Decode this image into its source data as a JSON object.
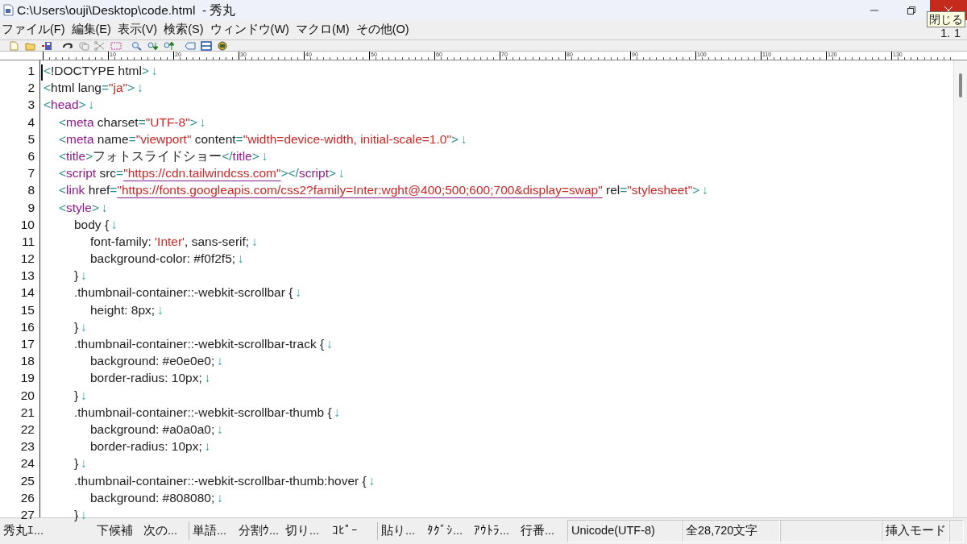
{
  "window": {
    "title": "C:\\Users\\ouji\\Desktop\\code.html  - 秀丸",
    "tooltip": "閉じる"
  },
  "menu": [
    "ファイル(F)",
    "編集(E)",
    "表示(V)",
    "検索(S)",
    "ウィンドウ(W)",
    "マクロ(M)",
    "その他(O)"
  ],
  "cursor_position": "1. 1",
  "ruler": [
    "10",
    "20",
    "30",
    "40",
    "50",
    "60",
    "70",
    "80",
    "90",
    "100",
    "110",
    "120",
    "130"
  ],
  "editor": {
    "lines": [
      {
        "number": "1",
        "kind": "top",
        "parts": [
          {
            "kind": "bracket",
            "text": "<"
          },
          {
            "kind": "text",
            "text": "!DOCTYPE html"
          },
          {
            "kind": "bracket",
            "text": ">"
          },
          {
            "kind": "eol",
            "text": "↓"
          }
        ]
      },
      {
        "number": "2",
        "kind": "top",
        "parts": [
          {
            "kind": "bracket",
            "text": "<"
          },
          {
            "kind": "text",
            "text": "html lang"
          },
          {
            "kind": "bracket",
            "text": "="
          },
          {
            "kind": "string",
            "text": "\"ja\""
          },
          {
            "kind": "bracket",
            "text": ">"
          },
          {
            "kind": "eol",
            "text": "↓"
          }
        ]
      },
      {
        "number": "3",
        "kind": "top",
        "parts": [
          {
            "kind": "bracket",
            "text": "<"
          },
          {
            "kind": "tag",
            "text": "head"
          },
          {
            "kind": "bracket",
            "text": ">"
          },
          {
            "kind": "eol",
            "text": "↓"
          }
        ]
      },
      {
        "number": "4",
        "kind": "element",
        "parts": [
          {
            "kind": "bracket",
            "text": "<"
          },
          {
            "kind": "tag",
            "text": "meta"
          },
          {
            "kind": "text",
            "text": " charset"
          },
          {
            "kind": "bracket",
            "text": "="
          },
          {
            "kind": "string",
            "text": "\"UTF-8\""
          },
          {
            "kind": "bracket",
            "text": ">"
          },
          {
            "kind": "eol",
            "text": "↓"
          }
        ]
      },
      {
        "number": "5",
        "kind": "element",
        "parts": [
          {
            "kind": "bracket",
            "text": "<"
          },
          {
            "kind": "tag",
            "text": "meta"
          },
          {
            "kind": "text",
            "text": " name"
          },
          {
            "kind": "bracket",
            "text": "="
          },
          {
            "kind": "string",
            "text": "\"viewport\""
          },
          {
            "kind": "text",
            "text": " content"
          },
          {
            "kind": "bracket",
            "text": "="
          },
          {
            "kind": "string",
            "text": "\"width=device-width, initial-scale=1.0\""
          },
          {
            "kind": "bracket",
            "text": ">"
          },
          {
            "kind": "eol",
            "text": "↓"
          }
        ]
      },
      {
        "number": "6",
        "kind": "element",
        "parts": [
          {
            "kind": "bracket",
            "text": "<"
          },
          {
            "kind": "tag",
            "text": "title"
          },
          {
            "kind": "bracket",
            "text": ">"
          },
          {
            "kind": "text",
            "text": "フォトスライドショー"
          },
          {
            "kind": "bracket",
            "text": "</"
          },
          {
            "kind": "tag",
            "text": "title"
          },
          {
            "kind": "bracket",
            "text": ">"
          },
          {
            "kind": "eol",
            "text": "↓"
          }
        ]
      },
      {
        "number": "7",
        "kind": "element",
        "parts": [
          {
            "kind": "bracket",
            "text": "<"
          },
          {
            "kind": "tag",
            "text": "script"
          },
          {
            "kind": "text",
            "text": " src"
          },
          {
            "kind": "bracket",
            "text": "="
          },
          {
            "kind": "url",
            "text": "\"https://cdn.tailwindcss.com\""
          },
          {
            "kind": "bracket",
            "text": "></"
          },
          {
            "kind": "tag",
            "text": "script"
          },
          {
            "kind": "bracket",
            "text": ">"
          },
          {
            "kind": "eol",
            "text": "↓"
          }
        ]
      },
      {
        "number": "8",
        "kind": "element",
        "parts": [
          {
            "kind": "bracket",
            "text": "<"
          },
          {
            "kind": "tag",
            "text": "link"
          },
          {
            "kind": "text",
            "text": " href"
          },
          {
            "kind": "bracket",
            "text": "="
          },
          {
            "kind": "url",
            "text": "\"https://fonts.googleapis.com/css2?family=Inter:wght@400;500;600;700&display=swap\""
          },
          {
            "kind": "text",
            "text": " rel"
          },
          {
            "kind": "bracket",
            "text": "="
          },
          {
            "kind": "string",
            "text": "\"stylesheet\""
          },
          {
            "kind": "bracket",
            "text": ">"
          },
          {
            "kind": "eol",
            "text": "↓"
          }
        ]
      },
      {
        "number": "9",
        "kind": "element",
        "parts": [
          {
            "kind": "bracket",
            "text": "<"
          },
          {
            "kind": "tag",
            "text": "style"
          },
          {
            "kind": "bracket",
            "text": ">"
          },
          {
            "kind": "eol",
            "text": "↓"
          }
        ]
      },
      {
        "number": "10",
        "kind": "selector",
        "parts": [
          {
            "kind": "text",
            "text": "body {"
          },
          {
            "kind": "eol",
            "text": "↓"
          }
        ]
      },
      {
        "number": "11",
        "kind": "declaration",
        "parts": [
          {
            "kind": "text",
            "text": "font-family: "
          },
          {
            "kind": "string",
            "text": "'Inter'"
          },
          {
            "kind": "text",
            "text": ", sans-serif;"
          },
          {
            "kind": "eol",
            "text": "↓"
          }
        ]
      },
      {
        "number": "12",
        "kind": "declaration",
        "parts": [
          {
            "kind": "text",
            "text": "background-color: #f0f2f5;"
          },
          {
            "kind": "eol",
            "text": "↓"
          }
        ]
      },
      {
        "number": "13",
        "kind": "selector",
        "parts": [
          {
            "kind": "text",
            "text": "}"
          },
          {
            "kind": "eol",
            "text": "↓"
          }
        ]
      },
      {
        "number": "14",
        "kind": "selector",
        "parts": [
          {
            "kind": "text",
            "text": ".thumbnail-container::-webkit-scrollbar {"
          },
          {
            "kind": "eol",
            "text": "↓"
          }
        ]
      },
      {
        "number": "15",
        "kind": "declaration",
        "parts": [
          {
            "kind": "text",
            "text": "height: 8px;"
          },
          {
            "kind": "eol",
            "text": "↓"
          }
        ]
      },
      {
        "number": "16",
        "kind": "selector",
        "parts": [
          {
            "kind": "text",
            "text": "}"
          },
          {
            "kind": "eol",
            "text": "↓"
          }
        ]
      },
      {
        "number": "17",
        "kind": "selector",
        "parts": [
          {
            "kind": "text",
            "text": ".thumbnail-container::-webkit-scrollbar-track {"
          },
          {
            "kind": "eol",
            "text": "↓"
          }
        ]
      },
      {
        "number": "18",
        "kind": "declaration",
        "parts": [
          {
            "kind": "text",
            "text": "background: #e0e0e0;"
          },
          {
            "kind": "eol",
            "text": "↓"
          }
        ]
      },
      {
        "number": "19",
        "kind": "declaration",
        "parts": [
          {
            "kind": "text",
            "text": "border-radius: 10px;"
          },
          {
            "kind": "eol",
            "text": "↓"
          }
        ]
      },
      {
        "number": "20",
        "kind": "selector",
        "parts": [
          {
            "kind": "text",
            "text": "}"
          },
          {
            "kind": "eol",
            "text": "↓"
          }
        ]
      },
      {
        "number": "21",
        "kind": "selector",
        "parts": [
          {
            "kind": "text",
            "text": ".thumbnail-container::-webkit-scrollbar-thumb {"
          },
          {
            "kind": "eol",
            "text": "↓"
          }
        ]
      },
      {
        "number": "22",
        "kind": "declaration",
        "parts": [
          {
            "kind": "text",
            "text": "background: #a0a0a0;"
          },
          {
            "kind": "eol",
            "text": "↓"
          }
        ]
      },
      {
        "number": "23",
        "kind": "declaration",
        "parts": [
          {
            "kind": "text",
            "text": "border-radius: 10px;"
          },
          {
            "kind": "eol",
            "text": "↓"
          }
        ]
      },
      {
        "number": "24",
        "kind": "selector",
        "parts": [
          {
            "kind": "text",
            "text": "}"
          },
          {
            "kind": "eol",
            "text": "↓"
          }
        ]
      },
      {
        "number": "25",
        "kind": "selector",
        "parts": [
          {
            "kind": "text",
            "text": ".thumbnail-container::-webkit-scrollbar-thumb:hover {"
          },
          {
            "kind": "eol",
            "text": "↓"
          }
        ]
      },
      {
        "number": "26",
        "kind": "declaration",
        "parts": [
          {
            "kind": "text",
            "text": "background: #808080;"
          },
          {
            "kind": "eol",
            "text": "↓"
          }
        ]
      },
      {
        "number": "27",
        "kind": "selector",
        "parts": [
          {
            "kind": "text",
            "text": "}"
          },
          {
            "kind": "eol",
            "text": "↓"
          }
        ]
      }
    ]
  },
  "function_keys": [
    {
      "label": "秀丸ｴ...",
      "kind": "wide"
    },
    {
      "label": "下候補",
      "kind": "normal"
    },
    {
      "label": "次の...",
      "kind": "normal"
    },
    {
      "label": "単語...",
      "kind": "group-start"
    },
    {
      "label": "分割ｳ...",
      "kind": "normal"
    },
    {
      "label": "切り...",
      "kind": "normal"
    },
    {
      "label": "ｺﾋﾟｰ",
      "kind": "normal"
    },
    {
      "label": "貼り...",
      "kind": "group-start"
    },
    {
      "label": "ﾀｸﾞｼ...",
      "kind": "normal"
    },
    {
      "label": "ｱｳﾄﾗ...",
      "kind": "normal"
    },
    {
      "label": "行番...",
      "kind": "normal"
    }
  ],
  "status_panels": [
    {
      "text": "Unicode(UTF-8)",
      "kind": "encoding"
    },
    {
      "text": "全28,720文字",
      "kind": "count"
    },
    {
      "kind": "blank"
    },
    {
      "text": "挿入モード",
      "kind": "mode"
    },
    {
      "kind": "grip"
    }
  ]
}
